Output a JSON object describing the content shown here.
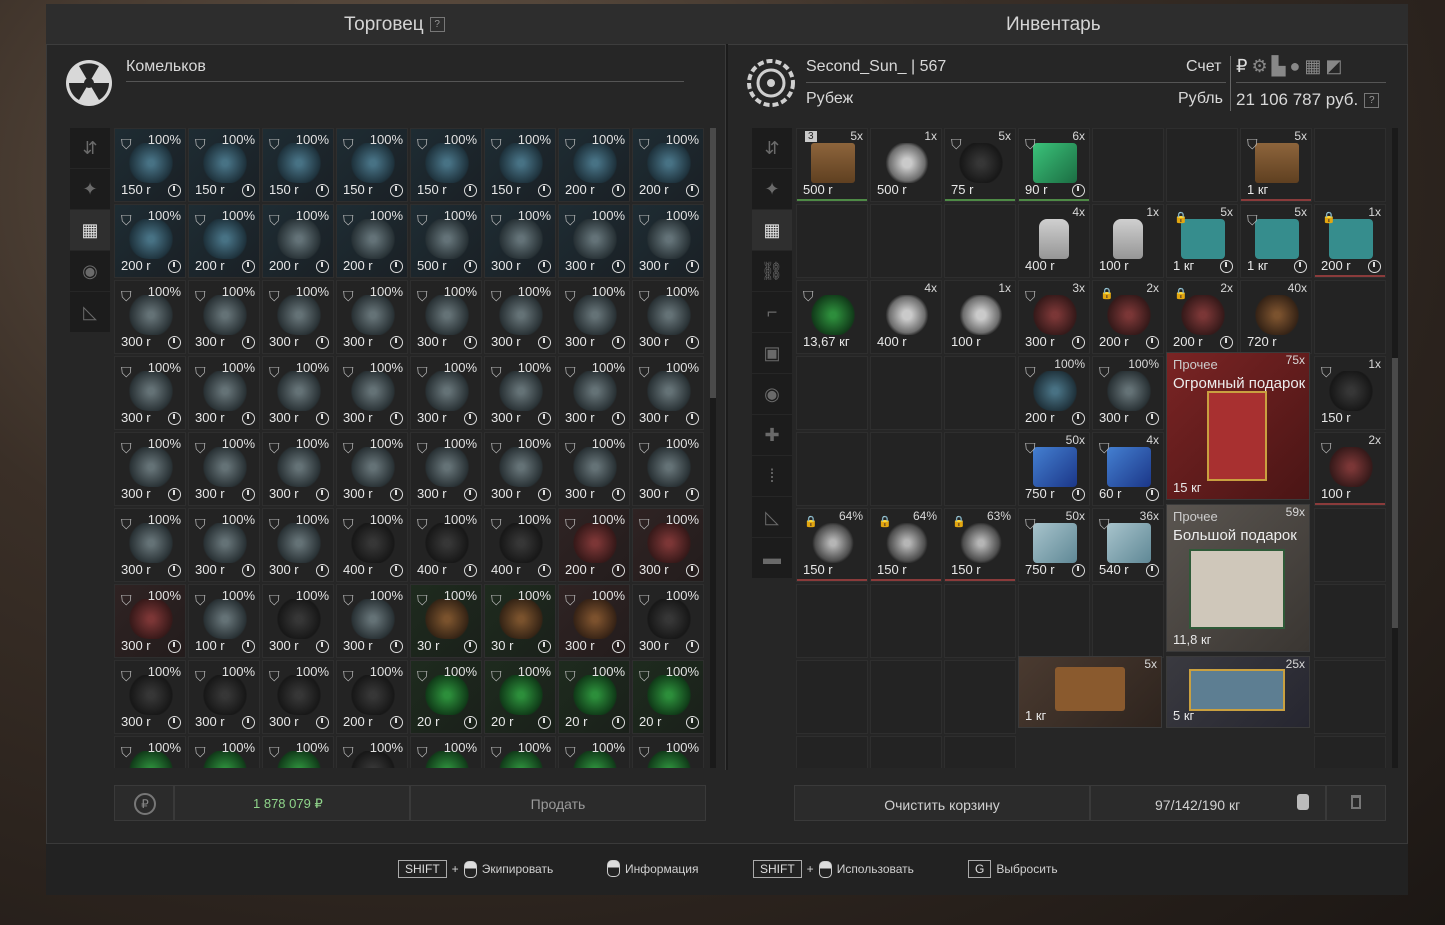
{
  "header": {
    "left_title": "Торговец",
    "left_help": "?",
    "right_title": "Инвентарь"
  },
  "trader": {
    "name": "Комельков",
    "icon": "radiation-icon"
  },
  "player": {
    "name": "Second_Sun_ | 567",
    "group": "Рубеж",
    "account_label": "Счет",
    "currency_label": "Рубль",
    "balance": "21 106 787 руб.",
    "help": "?",
    "currency_icons": [
      "ruble-icon",
      "gear-icon",
      "boot-icon",
      "pill-icon",
      "crate-icon",
      "mug-icon"
    ]
  },
  "trader_grid": [
    {
      "d": "100%",
      "p": "150 r",
      "c": "blue",
      "a": "blueish"
    },
    {
      "d": "100%",
      "p": "150 r",
      "c": "blue",
      "a": "blueish"
    },
    {
      "d": "100%",
      "p": "150 r",
      "c": "blue",
      "a": "blueish"
    },
    {
      "d": "100%",
      "p": "150 r",
      "c": "blue",
      "a": "blueish"
    },
    {
      "d": "100%",
      "p": "150 r",
      "c": "blue",
      "a": "blueish"
    },
    {
      "d": "100%",
      "p": "150 r",
      "c": "blue",
      "a": "blueish"
    },
    {
      "d": "100%",
      "p": "200 r",
      "c": "blue",
      "a": "blueish"
    },
    {
      "d": "100%",
      "p": "200 r",
      "c": "blue",
      "a": "blueish"
    },
    {
      "d": "100%",
      "p": "200 r",
      "c": "blue",
      "a": "blueish"
    },
    {
      "d": "100%",
      "p": "200 r",
      "c": "blue",
      "a": "blueish"
    },
    {
      "d": "100%",
      "p": "200 r",
      "c": "blue",
      "a": "gray"
    },
    {
      "d": "100%",
      "p": "200 r",
      "c": "blue",
      "a": "gray"
    },
    {
      "d": "100%",
      "p": "500 r",
      "c": "blue",
      "a": "gray"
    },
    {
      "d": "100%",
      "p": "300 r",
      "c": "blue",
      "a": "gray"
    },
    {
      "d": "100%",
      "p": "300 r",
      "c": "blue",
      "a": "gray"
    },
    {
      "d": "100%",
      "p": "300 r",
      "c": "blue",
      "a": "gray"
    },
    {
      "d": "100%",
      "p": "300 r",
      "c": "",
      "a": "gray"
    },
    {
      "d": "100%",
      "p": "300 r",
      "c": "",
      "a": "gray"
    },
    {
      "d": "100%",
      "p": "300 r",
      "c": "",
      "a": "gray"
    },
    {
      "d": "100%",
      "p": "300 r",
      "c": "",
      "a": "gray"
    },
    {
      "d": "100%",
      "p": "300 r",
      "c": "",
      "a": "gray"
    },
    {
      "d": "100%",
      "p": "300 r",
      "c": "",
      "a": "gray"
    },
    {
      "d": "100%",
      "p": "300 r",
      "c": "",
      "a": "gray"
    },
    {
      "d": "100%",
      "p": "300 r",
      "c": "",
      "a": "gray"
    },
    {
      "d": "100%",
      "p": "300 r",
      "c": "",
      "a": "gray"
    },
    {
      "d": "100%",
      "p": "300 r",
      "c": "",
      "a": "gray"
    },
    {
      "d": "100%",
      "p": "300 r",
      "c": "",
      "a": "gray"
    },
    {
      "d": "100%",
      "p": "300 r",
      "c": "",
      "a": "gray"
    },
    {
      "d": "100%",
      "p": "300 r",
      "c": "",
      "a": "gray"
    },
    {
      "d": "100%",
      "p": "300 r",
      "c": "",
      "a": "gray"
    },
    {
      "d": "100%",
      "p": "300 r",
      "c": "",
      "a": "gray"
    },
    {
      "d": "100%",
      "p": "300 r",
      "c": "",
      "a": "gray"
    },
    {
      "d": "100%",
      "p": "300 r",
      "c": "",
      "a": "gray"
    },
    {
      "d": "100%",
      "p": "300 r",
      "c": "",
      "a": "gray"
    },
    {
      "d": "100%",
      "p": "300 r",
      "c": "",
      "a": "gray"
    },
    {
      "d": "100%",
      "p": "300 r",
      "c": "",
      "a": "gray"
    },
    {
      "d": "100%",
      "p": "300 r",
      "c": "",
      "a": "gray"
    },
    {
      "d": "100%",
      "p": "300 r",
      "c": "",
      "a": "gray"
    },
    {
      "d": "100%",
      "p": "300 r",
      "c": "",
      "a": "gray"
    },
    {
      "d": "100%",
      "p": "300 r",
      "c": "",
      "a": "gray"
    },
    {
      "d": "100%",
      "p": "300 r",
      "c": "",
      "a": "gray"
    },
    {
      "d": "100%",
      "p": "300 r",
      "c": "",
      "a": "gray"
    },
    {
      "d": "100%",
      "p": "300 r",
      "c": "",
      "a": "gray"
    },
    {
      "d": "100%",
      "p": "400 r",
      "c": "",
      "a": "dark"
    },
    {
      "d": "100%",
      "p": "400 r",
      "c": "",
      "a": "dark"
    },
    {
      "d": "100%",
      "p": "400 r",
      "c": "",
      "a": "dark"
    },
    {
      "d": "100%",
      "p": "200 r",
      "c": "red",
      "a": "redish"
    },
    {
      "d": "100%",
      "p": "300 r",
      "c": "red",
      "a": "redish"
    },
    {
      "d": "100%",
      "p": "300 r",
      "c": "red",
      "a": "redish"
    },
    {
      "d": "100%",
      "p": "100 r",
      "c": "",
      "a": "gray"
    },
    {
      "d": "100%",
      "p": "300 r",
      "c": "",
      "a": "dark"
    },
    {
      "d": "100%",
      "p": "300 r",
      "c": "",
      "a": "gray"
    },
    {
      "d": "100%",
      "p": "30 r",
      "c": "green",
      "a": "brown"
    },
    {
      "d": "100%",
      "p": "30 r",
      "c": "green",
      "a": "brown"
    },
    {
      "d": "100%",
      "p": "300 r",
      "c": "red",
      "a": "brown"
    },
    {
      "d": "100%",
      "p": "300 r",
      "c": "",
      "a": "dark"
    },
    {
      "d": "100%",
      "p": "300 r",
      "c": "",
      "a": "dark"
    },
    {
      "d": "100%",
      "p": "300 r",
      "c": "",
      "a": "dark"
    },
    {
      "d": "100%",
      "p": "300 r",
      "c": "",
      "a": "dark"
    },
    {
      "d": "100%",
      "p": "200 r",
      "c": "",
      "a": "dark"
    },
    {
      "d": "100%",
      "p": "20 r",
      "c": "green",
      "a": "greenish"
    },
    {
      "d": "100%",
      "p": "20 r",
      "c": "green",
      "a": "greenish"
    },
    {
      "d": "100%",
      "p": "20 r",
      "c": "green",
      "a": "greenish"
    },
    {
      "d": "100%",
      "p": "20 r",
      "c": "green",
      "a": "greenish"
    },
    {
      "d": "100%",
      "p": "",
      "c": "",
      "a": "greenish"
    },
    {
      "d": "100%",
      "p": "",
      "c": "",
      "a": "greenish"
    },
    {
      "d": "100%",
      "p": "",
      "c": "",
      "a": "greenish"
    },
    {
      "d": "100%",
      "p": "",
      "c": "",
      "a": "dark"
    },
    {
      "d": "100%",
      "p": "",
      "c": "",
      "a": "greenish"
    },
    {
      "d": "100%",
      "p": "",
      "c": "",
      "a": "greenish"
    },
    {
      "d": "100%",
      "p": "",
      "c": "",
      "a": "greenish"
    },
    {
      "d": "100%",
      "p": "",
      "c": "",
      "a": "greenish"
    }
  ],
  "trader_footer": {
    "total": "1 878 079 ₽",
    "sell": "Продать"
  },
  "inventory_grid": [
    {
      "q": "5x",
      "p": "500 r",
      "a": "box",
      "badge": "3",
      "line": "sel"
    },
    {
      "q": "1x",
      "p": "500 r",
      "a": "white"
    },
    {
      "q": "5x",
      "p": "75 r",
      "a": "dark",
      "sh": true,
      "line": "sel"
    },
    {
      "q": "6x",
      "p": "90 r",
      "a": "gem",
      "sh": true,
      "clk": true,
      "line": "sel"
    },
    {
      "e": true
    },
    {
      "e": true
    },
    {
      "q": "5x",
      "p": "1 кг",
      "a": "box",
      "sh": true,
      "line": "redline"
    },
    {
      "e": true
    },
    {
      "e": true
    },
    {
      "e": true
    },
    {
      "e": true
    },
    {
      "q": "4x",
      "p": "400 r",
      "a": "bottle"
    },
    {
      "q": "1x",
      "p": "100 r",
      "a": "bottle"
    },
    {
      "q": "5x",
      "p": "1 кг",
      "a": "med",
      "lk": true,
      "clk": true
    },
    {
      "q": "5x",
      "p": "1 кг",
      "a": "med",
      "sh": true,
      "clk": true
    },
    {
      "q": "1x",
      "p": "200 r",
      "a": "med",
      "lk": true,
      "clk": true,
      "line": "redline"
    },
    {
      "q": "",
      "p": "13,67 кг",
      "a": "greenish",
      "sh": true
    },
    {
      "q": "4x",
      "p": "400 r",
      "a": "white"
    },
    {
      "q": "1x",
      "p": "100 r",
      "a": "white"
    },
    {
      "q": "3x",
      "p": "300 r",
      "a": "redish",
      "sh": true,
      "clk": true
    },
    {
      "q": "2x",
      "p": "200 r",
      "a": "redish",
      "lk": true,
      "clk": true
    },
    {
      "q": "2x",
      "p": "200 r",
      "a": "redish",
      "lk": true,
      "clk": true
    },
    {
      "q": "40x",
      "p": "720 r",
      "a": "brown"
    },
    {
      "e": true
    },
    {
      "e": true
    },
    {
      "e": true
    },
    {
      "e": true
    },
    {
      "q": "100%",
      "p": "200 r",
      "a": "blueish",
      "sh": true,
      "clk": true
    },
    {
      "q": "100%",
      "p": "300 r",
      "a": "gray",
      "sh": true,
      "clk": true
    },
    {
      "big": true
    },
    {
      "big": true
    },
    {
      "q": "1x",
      "p": "150 r",
      "a": "dark",
      "sh": true
    },
    {
      "e": true
    },
    {
      "e": true
    },
    {
      "e": true
    },
    {
      "q": "50x",
      "p": "750 r",
      "a": "bluegem",
      "sh": true,
      "clk": true
    },
    {
      "q": "4x",
      "p": "60 r",
      "a": "bluegem",
      "sh": true,
      "clk": true
    },
    {
      "big": true
    },
    {
      "big": true
    },
    {
      "q": "2x",
      "p": "100 r",
      "a": "redish",
      "sh": true,
      "line": "redline"
    },
    {
      "q": "64%",
      "p": "150 r",
      "a": "spiral",
      "lk": true,
      "line": "redline"
    },
    {
      "q": "64%",
      "p": "150 r",
      "a": "spiral",
      "lk": true,
      "line": "redline"
    },
    {
      "q": "63%",
      "p": "150 r",
      "a": "spiral",
      "lk": true,
      "line": "redline"
    },
    {
      "q": "50x",
      "p": "750 r",
      "a": "ice",
      "sh": true,
      "clk": true
    },
    {
      "q": "36x",
      "p": "540 r",
      "a": "ice",
      "sh": true,
      "clk": true
    },
    {
      "big": true
    },
    {
      "big": true
    },
    {
      "e": true
    },
    {
      "e": true
    },
    {
      "e": true
    },
    {
      "e": true
    },
    {
      "e": true
    },
    {
      "e": true
    },
    {
      "big": true
    },
    {
      "big": true
    },
    {
      "e": true
    },
    {
      "e": true
    },
    {
      "e": true
    },
    {
      "e": true
    },
    {
      "big": true
    },
    {
      "big": true
    },
    {
      "big": true
    },
    {
      "big": true
    },
    {
      "e": true
    },
    {
      "e": true
    },
    {
      "e": true
    },
    {
      "e": true
    },
    {
      "big": true
    },
    {
      "big": true
    },
    {
      "big": true
    },
    {
      "big": true
    },
    {
      "e": true
    }
  ],
  "gifts": [
    {
      "category": "Прочее",
      "name": "Огромный подарок",
      "qty": "75x",
      "weight": "15 кг",
      "color": "#7a2424"
    },
    {
      "category": "Прочее",
      "name": "Большой подарок",
      "qty": "59x",
      "weight": "11,8 кг",
      "color": "#8f8a80"
    },
    {
      "qty": "5x",
      "weight": "1 кг",
      "color": "#8a5a2e"
    },
    {
      "qty": "25x",
      "weight": "5 кг",
      "color": "#5d7e92"
    }
  ],
  "inventory_footer": {
    "clear": "Очистить корзину",
    "weight": "97/142/190 кг"
  },
  "hints": [
    {
      "key": "SHIFT",
      "plus": "+",
      "label": "Экипировать"
    },
    {
      "label": "Информация"
    },
    {
      "key": "SHIFT",
      "plus": "+",
      "label": "Использовать"
    },
    {
      "key": "G",
      "label": "Выбросить"
    }
  ]
}
